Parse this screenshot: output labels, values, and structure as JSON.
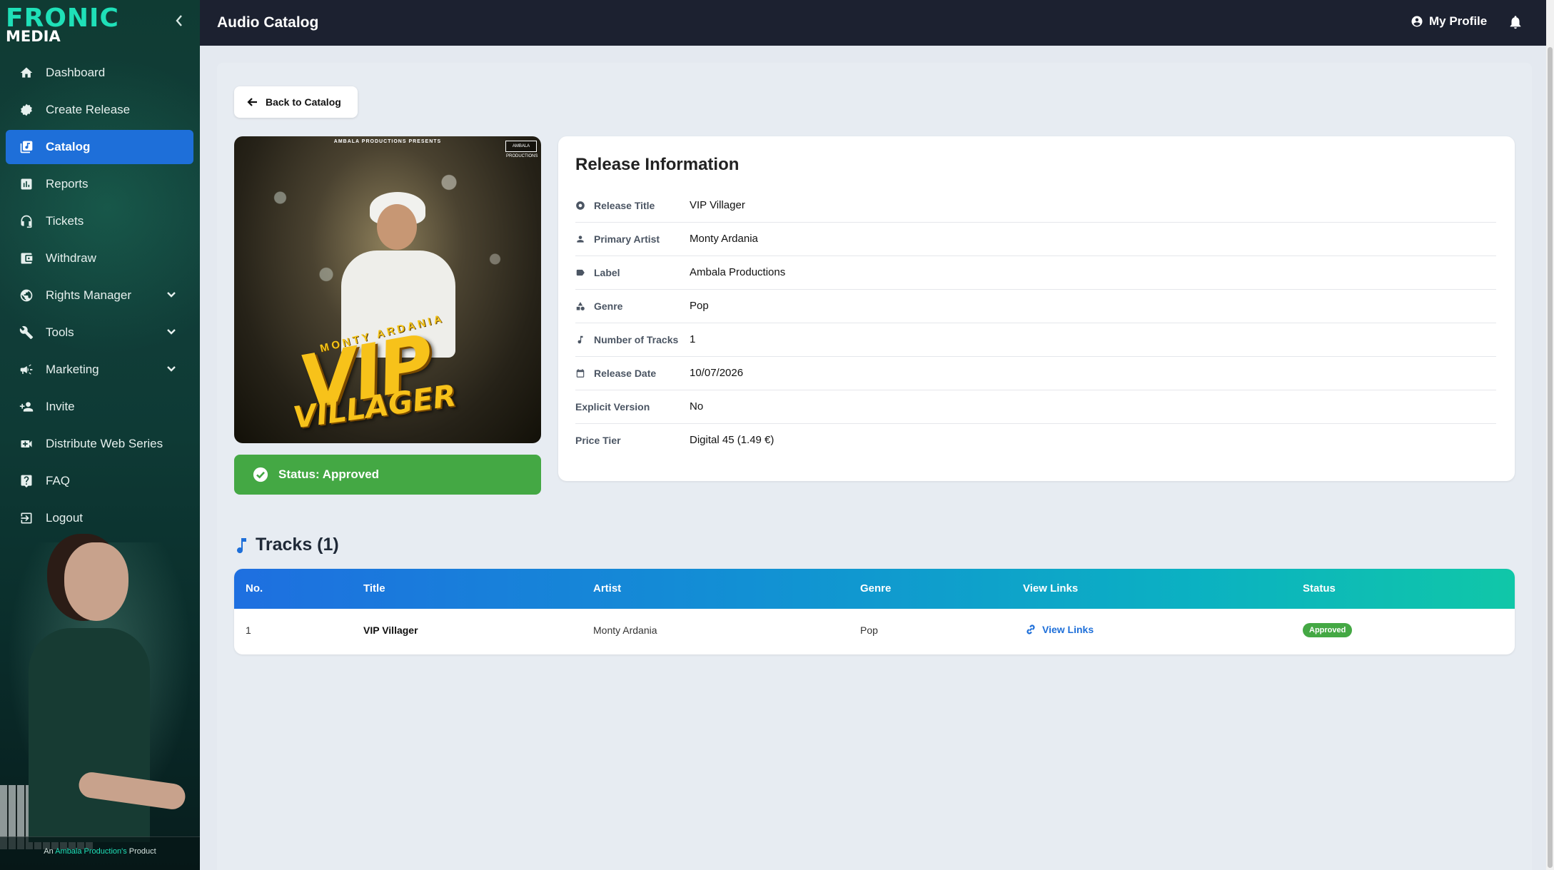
{
  "brand": {
    "logo_line1_a": "FRO",
    "logo_line1_b": "NIC",
    "logo_line2": "MEDIA",
    "footer_prefix": "An ",
    "footer_highlight": "Ambala Production's",
    "footer_suffix": " Product"
  },
  "sidebar": {
    "items": [
      {
        "label": "Dashboard",
        "icon": "home-icon",
        "active": false,
        "has_submenu": false
      },
      {
        "label": "Create Release",
        "icon": "gear-badge-icon",
        "active": false,
        "has_submenu": false
      },
      {
        "label": "Catalog",
        "icon": "music-library-icon",
        "active": true,
        "has_submenu": false
      },
      {
        "label": "Reports",
        "icon": "bar-chart-icon",
        "active": false,
        "has_submenu": false
      },
      {
        "label": "Tickets",
        "icon": "headset-icon",
        "active": false,
        "has_submenu": false
      },
      {
        "label": "Withdraw",
        "icon": "wallet-icon",
        "active": false,
        "has_submenu": false
      },
      {
        "label": "Rights Manager",
        "icon": "globe-icon",
        "active": false,
        "has_submenu": true
      },
      {
        "label": "Tools",
        "icon": "wrench-icon",
        "active": false,
        "has_submenu": true
      },
      {
        "label": "Marketing",
        "icon": "megaphone-icon",
        "active": false,
        "has_submenu": true
      },
      {
        "label": "Invite",
        "icon": "person-add-icon",
        "active": false,
        "has_submenu": false
      },
      {
        "label": "Distribute Web Series",
        "icon": "video-icon",
        "active": false,
        "has_submenu": false
      },
      {
        "label": "FAQ",
        "icon": "help-icon",
        "active": false,
        "has_submenu": false
      },
      {
        "label": "Logout",
        "icon": "logout-icon",
        "active": false,
        "has_submenu": false
      }
    ]
  },
  "header": {
    "title": "Audio Catalog",
    "profile_label": "My Profile"
  },
  "back_button": {
    "label": "Back to Catalog"
  },
  "cover": {
    "pretitle": "AMBALA PRODUCTIONS PRESENTS",
    "badge": "AMBALA PRODUCTIONS",
    "artist_text": "MONTY ARDANIA",
    "title_line1": "VIP",
    "title_line2": "VILLAGER"
  },
  "status_banner": {
    "label": "Status: Approved",
    "color": "#44a844"
  },
  "release_info": {
    "heading": "Release Information",
    "rows": [
      {
        "key": "Release Title",
        "value": "VIP Villager",
        "icon": "disc-icon"
      },
      {
        "key": "Primary Artist",
        "value": "Monty Ardania",
        "icon": "person-icon"
      },
      {
        "key": "Label",
        "value": "Ambala Productions",
        "icon": "tag-icon"
      },
      {
        "key": "Genre",
        "value": "Pop",
        "icon": "shapes-icon"
      },
      {
        "key": "Number of Tracks",
        "value": "1",
        "icon": "music-note-icon"
      },
      {
        "key": "Release Date",
        "value": "10/07/2026",
        "icon": "calendar-icon"
      },
      {
        "key": "Explicit Version",
        "value": "No",
        "icon": ""
      },
      {
        "key": "Price Tier",
        "value": "Digital 45 (1.49 €)",
        "icon": ""
      }
    ]
  },
  "tracks": {
    "heading": "Tracks (1)",
    "columns": [
      "No.",
      "Title",
      "Artist",
      "Genre",
      "View Links",
      "Status"
    ],
    "rows": [
      {
        "no": "1",
        "title": "VIP Villager",
        "artist": "Monty Ardania",
        "genre": "Pop",
        "view_links": "View Links",
        "status": "Approved"
      }
    ]
  },
  "colors": {
    "accent": "#1e6fd9",
    "approved": "#44a844",
    "topbar": "#1c2130",
    "logo_teal": "#1fe0b8"
  }
}
